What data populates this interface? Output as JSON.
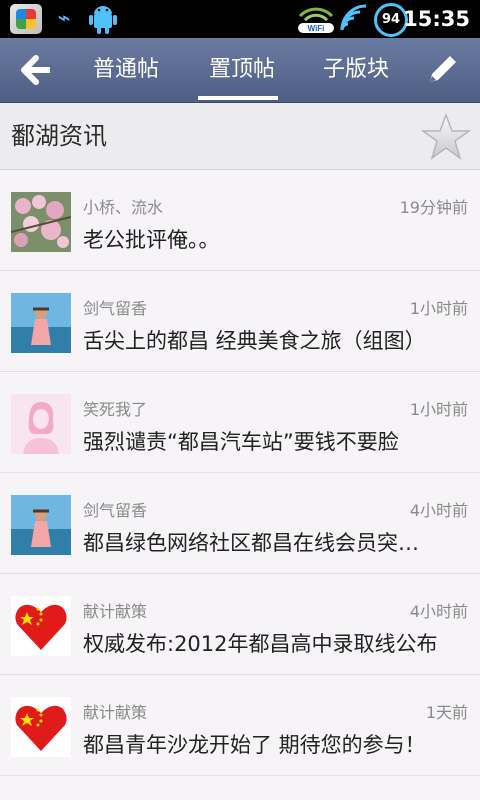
{
  "status_bar": {
    "battery_level": "94",
    "time": "15:35",
    "icons": [
      "app-store-icon",
      "usb-icon",
      "android-icon",
      "wifi-icon",
      "signal-icon",
      "battery-icon"
    ]
  },
  "nav": {
    "tabs": [
      {
        "label": "普通帖"
      },
      {
        "label": "置顶帖"
      },
      {
        "label": "子版块"
      }
    ],
    "active_tab": "置顶帖"
  },
  "section": {
    "title": "鄱湖资讯"
  },
  "posts": [
    {
      "author": "小桥、流水",
      "time": "19分钟前",
      "title": "老公批评俺。。",
      "avatar": "flowers-avatar"
    },
    {
      "author": "剑气留香",
      "time": "1小时前",
      "title": "舌尖上的都昌 经典美食之旅（组图）",
      "avatar": "beach-avatar"
    },
    {
      "author": "笑死我了",
      "time": "1小时前",
      "title": "强烈谴责“都昌汽车站”要钱不要脸",
      "avatar": "pink-silhouette-avatar"
    },
    {
      "author": "剑气留香",
      "time": "4小时前",
      "title": "都昌绿色网络社区都昌在线会员突…",
      "avatar": "beach-avatar"
    },
    {
      "author": "献计献策",
      "time": "4小时前",
      "title": "权威发布:2012年都昌高中录取线公布",
      "avatar": "heart-flag-avatar"
    },
    {
      "author": "献计献策",
      "time": "1天前",
      "title": "都昌青年沙龙开始了 期待您的参与！",
      "avatar": "heart-flag-avatar"
    }
  ],
  "colors": {
    "nav_bg": "#5a6990",
    "page_bg": "#f6f4f7",
    "header_bg": "#ecebee"
  }
}
